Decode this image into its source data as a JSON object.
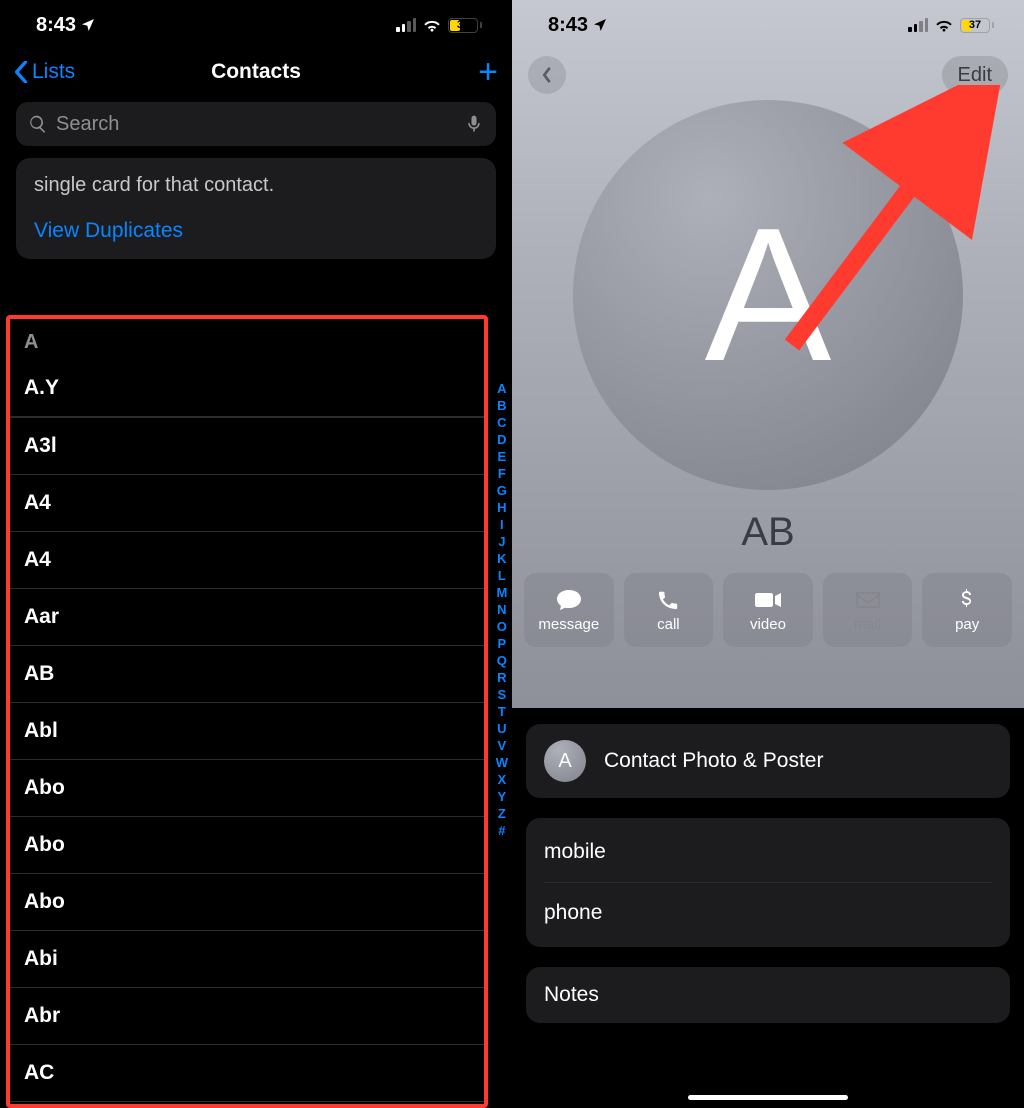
{
  "status": {
    "time": "8:43",
    "battery_pct": "37"
  },
  "left": {
    "nav_back": "Lists",
    "nav_title": "Contacts",
    "search_placeholder": "Search",
    "dup_text": "single card for that contact.",
    "dup_link": "View Duplicates",
    "section": "A",
    "alpha_index": [
      "A",
      "B",
      "C",
      "D",
      "E",
      "F",
      "G",
      "H",
      "I",
      "J",
      "K",
      "L",
      "M",
      "N",
      "O",
      "P",
      "Q",
      "R",
      "S",
      "T",
      "U",
      "V",
      "W",
      "X",
      "Y",
      "Z",
      "#"
    ],
    "rows": [
      "A.Y",
      "A3l",
      "A4",
      "A4",
      "Aar",
      "AB",
      "Abl",
      "Abo",
      "Abo",
      "Abo",
      "Abi",
      "Abr",
      "AC"
    ]
  },
  "right": {
    "edit": "Edit",
    "initial": "A",
    "name": "AB",
    "actions": {
      "message": "message",
      "call": "call",
      "video": "video",
      "mail": "mail",
      "pay": "pay"
    },
    "photo_row": "Contact Photo & Poster",
    "mini_initial": "A",
    "fields": {
      "mobile": "mobile",
      "phone": "phone"
    },
    "notes": "Notes"
  }
}
